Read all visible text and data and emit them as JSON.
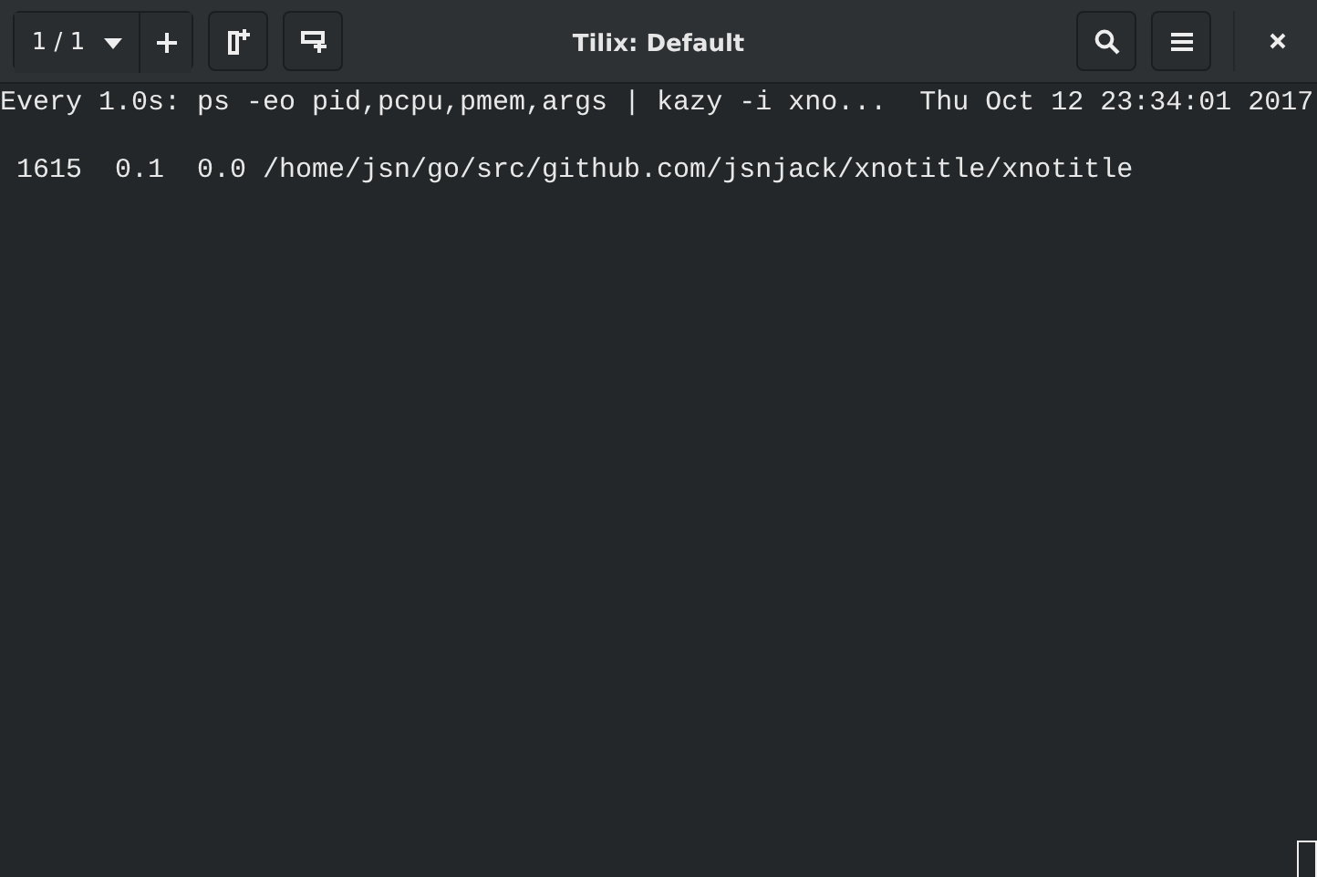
{
  "window": {
    "title": "Tilix: Default"
  },
  "session_selector": {
    "label": "1 / 1"
  },
  "terminal": {
    "header": "Every 1.0s: ps -eo pid,pcpu,pmem,args | kazy -i xno...  Thu Oct 12 23:34:01 2017",
    "rows": [
      " 1615  0.1  0.0 /home/jsn/go/src/github.com/jsnjack/xnotitle/xnotitle"
    ]
  }
}
